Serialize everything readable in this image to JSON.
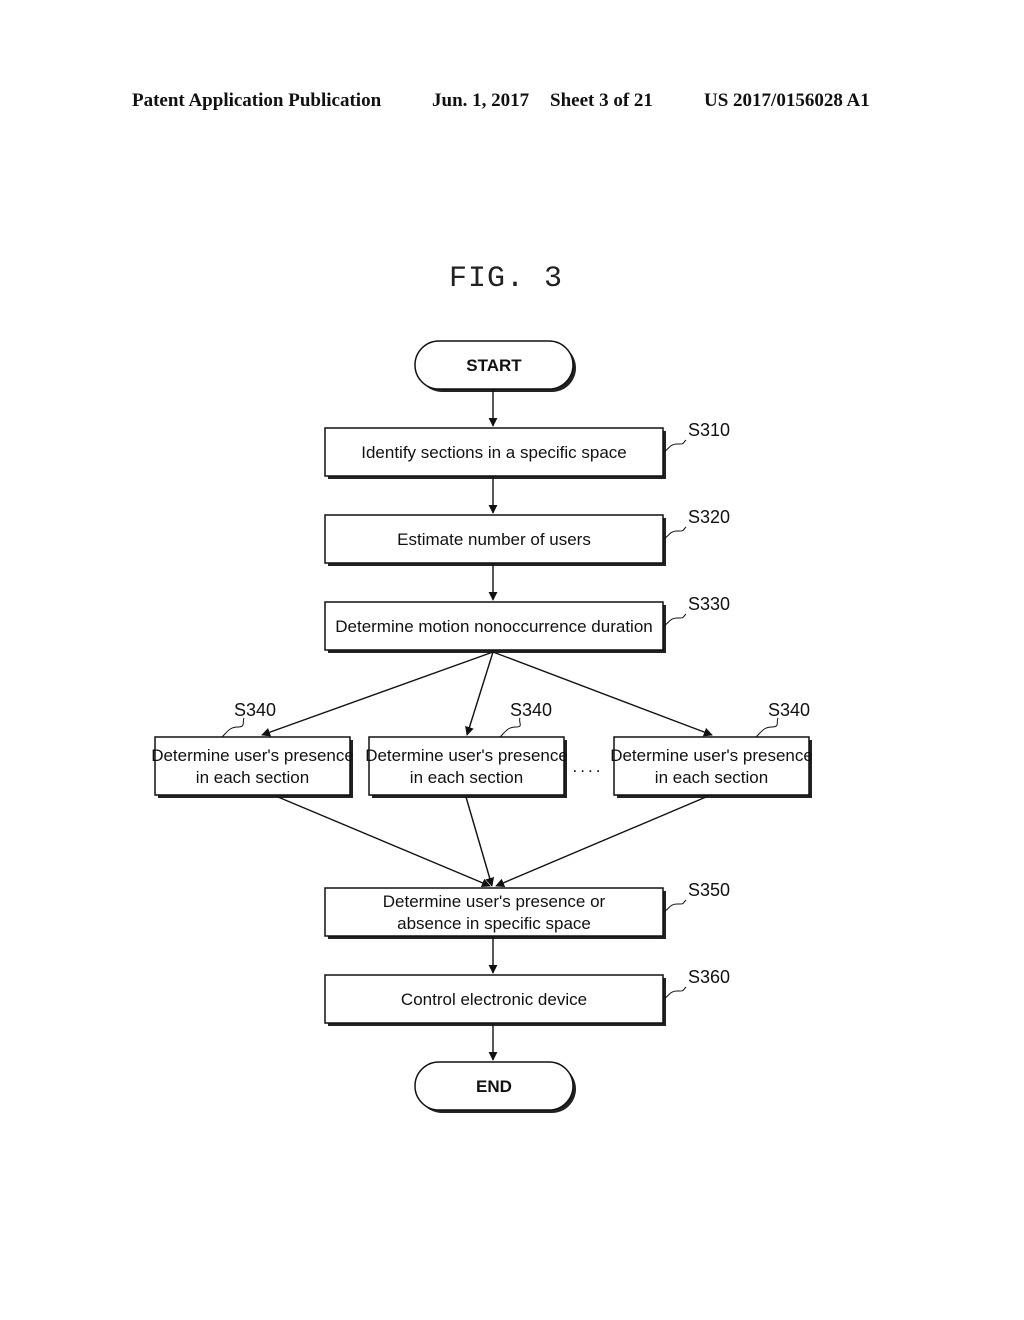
{
  "header": {
    "publication": "Patent Application Publication",
    "date": "Jun. 1, 2017",
    "sheet": "Sheet 3 of 21",
    "number": "US 2017/0156028 A1"
  },
  "figure": {
    "title": "FIG. 3"
  },
  "flowchart": {
    "start": "START",
    "end": "END",
    "steps": [
      {
        "id": "S310",
        "lines": [
          "Identify sections in a specific space"
        ]
      },
      {
        "id": "S320",
        "lines": [
          "Estimate number of users"
        ]
      },
      {
        "id": "S330",
        "lines": [
          "Determine motion nonoccurrence duration"
        ]
      },
      {
        "id": "S340",
        "lines": [
          "Determine user's presence",
          "in each section"
        ]
      },
      {
        "id": "S340",
        "lines": [
          "Determine user's presence",
          "in each section"
        ]
      },
      {
        "id": "S340",
        "lines": [
          "Determine user's presence",
          "in each section"
        ]
      },
      {
        "id": "S350",
        "lines": [
          "Determine user's presence or",
          "absence in specific space"
        ]
      },
      {
        "id": "S360",
        "lines": [
          "Control electronic device"
        ]
      }
    ],
    "ellipsis": "...."
  }
}
